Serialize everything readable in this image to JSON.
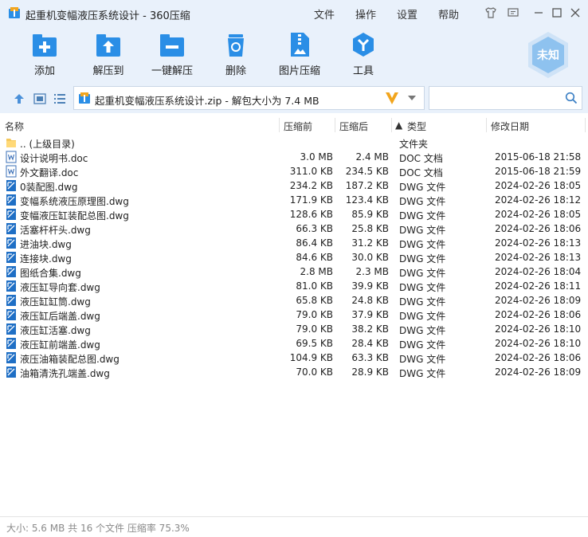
{
  "window": {
    "title": "起重机变幅液压系统设计 - 360压缩",
    "menus": [
      "文件",
      "操作",
      "设置",
      "帮助"
    ]
  },
  "toolbar": {
    "items": [
      {
        "label": "添加",
        "icon": "add-icon"
      },
      {
        "label": "解压到",
        "icon": "extract-to-icon"
      },
      {
        "label": "一键解压",
        "icon": "one-click-extract-icon"
      },
      {
        "label": "删除",
        "icon": "delete-icon"
      },
      {
        "label": "图片压缩",
        "icon": "image-compress-icon"
      },
      {
        "label": "工具",
        "icon": "tools-icon"
      }
    ],
    "badge_label": "未知"
  },
  "address": {
    "path": "起重机变幅液压系统设计.zip - 解包大小为 7.4 MB",
    "search_value": ""
  },
  "columns": {
    "name": "名称",
    "compressed": "压缩前",
    "original": "压缩后",
    "type": "类型",
    "type_sort_indicator": "▲",
    "date": "修改日期"
  },
  "files": [
    {
      "name": ".. (上级目录)",
      "compressed": "",
      "original": "",
      "type": "文件夹",
      "date": "",
      "icon": "folder-icon"
    },
    {
      "name": "设计说明书.doc",
      "compressed": "3.0 MB",
      "original": "2.4 MB",
      "type": "DOC 文档",
      "date": "2015-06-18 21:58",
      "icon": "doc-icon"
    },
    {
      "name": "外文翻译.doc",
      "compressed": "311.0 KB",
      "original": "234.5 KB",
      "type": "DOC 文档",
      "date": "2015-06-18 21:59",
      "icon": "doc-icon"
    },
    {
      "name": "0装配图.dwg",
      "compressed": "234.2 KB",
      "original": "187.2 KB",
      "type": "DWG 文件",
      "date": "2024-02-26 18:05",
      "icon": "dwg-icon"
    },
    {
      "name": "变幅系统液压原理图.dwg",
      "compressed": "171.9 KB",
      "original": "123.4 KB",
      "type": "DWG 文件",
      "date": "2024-02-26 18:12",
      "icon": "dwg-icon"
    },
    {
      "name": "变幅液压缸装配总图.dwg",
      "compressed": "128.6 KB",
      "original": "85.9 KB",
      "type": "DWG 文件",
      "date": "2024-02-26 18:05",
      "icon": "dwg-icon"
    },
    {
      "name": "活塞杆杆头.dwg",
      "compressed": "66.3 KB",
      "original": "25.8 KB",
      "type": "DWG 文件",
      "date": "2024-02-26 18:06",
      "icon": "dwg-icon"
    },
    {
      "name": "进油块.dwg",
      "compressed": "86.4 KB",
      "original": "31.2 KB",
      "type": "DWG 文件",
      "date": "2024-02-26 18:13",
      "icon": "dwg-icon"
    },
    {
      "name": "连接块.dwg",
      "compressed": "84.6 KB",
      "original": "30.0 KB",
      "type": "DWG 文件",
      "date": "2024-02-26 18:13",
      "icon": "dwg-icon"
    },
    {
      "name": "图纸合集.dwg",
      "compressed": "2.8 MB",
      "original": "2.3 MB",
      "type": "DWG 文件",
      "date": "2024-02-26 18:04",
      "icon": "dwg-icon"
    },
    {
      "name": "液压缸导向套.dwg",
      "compressed": "81.0 KB",
      "original": "39.9 KB",
      "type": "DWG 文件",
      "date": "2024-02-26 18:11",
      "icon": "dwg-icon"
    },
    {
      "name": "液压缸缸筒.dwg",
      "compressed": "65.8 KB",
      "original": "24.8 KB",
      "type": "DWG 文件",
      "date": "2024-02-26 18:09",
      "icon": "dwg-icon"
    },
    {
      "name": "液压缸后端盖.dwg",
      "compressed": "79.0 KB",
      "original": "37.9 KB",
      "type": "DWG 文件",
      "date": "2024-02-26 18:06",
      "icon": "dwg-icon"
    },
    {
      "name": "液压缸活塞.dwg",
      "compressed": "79.0 KB",
      "original": "38.2 KB",
      "type": "DWG 文件",
      "date": "2024-02-26 18:10",
      "icon": "dwg-icon"
    },
    {
      "name": "液压缸前端盖.dwg",
      "compressed": "69.5 KB",
      "original": "28.4 KB",
      "type": "DWG 文件",
      "date": "2024-02-26 18:10",
      "icon": "dwg-icon"
    },
    {
      "name": "液压油箱装配总图.dwg",
      "compressed": "104.9 KB",
      "original": "63.3 KB",
      "type": "DWG 文件",
      "date": "2024-02-26 18:06",
      "icon": "dwg-icon"
    },
    {
      "name": "油箱清洗孔端盖.dwg",
      "compressed": "70.0 KB",
      "original": "28.9 KB",
      "type": "DWG 文件",
      "date": "2024-02-26 18:09",
      "icon": "dwg-icon"
    }
  ],
  "status": {
    "text": "大小: 5.6 MB 共 16 个文件 压缩率 75.3%"
  },
  "colors": {
    "chrome_bg": "#e9f1fb",
    "icon_blue": "#2a8ee6",
    "accent_orange": "#f2a51d"
  }
}
